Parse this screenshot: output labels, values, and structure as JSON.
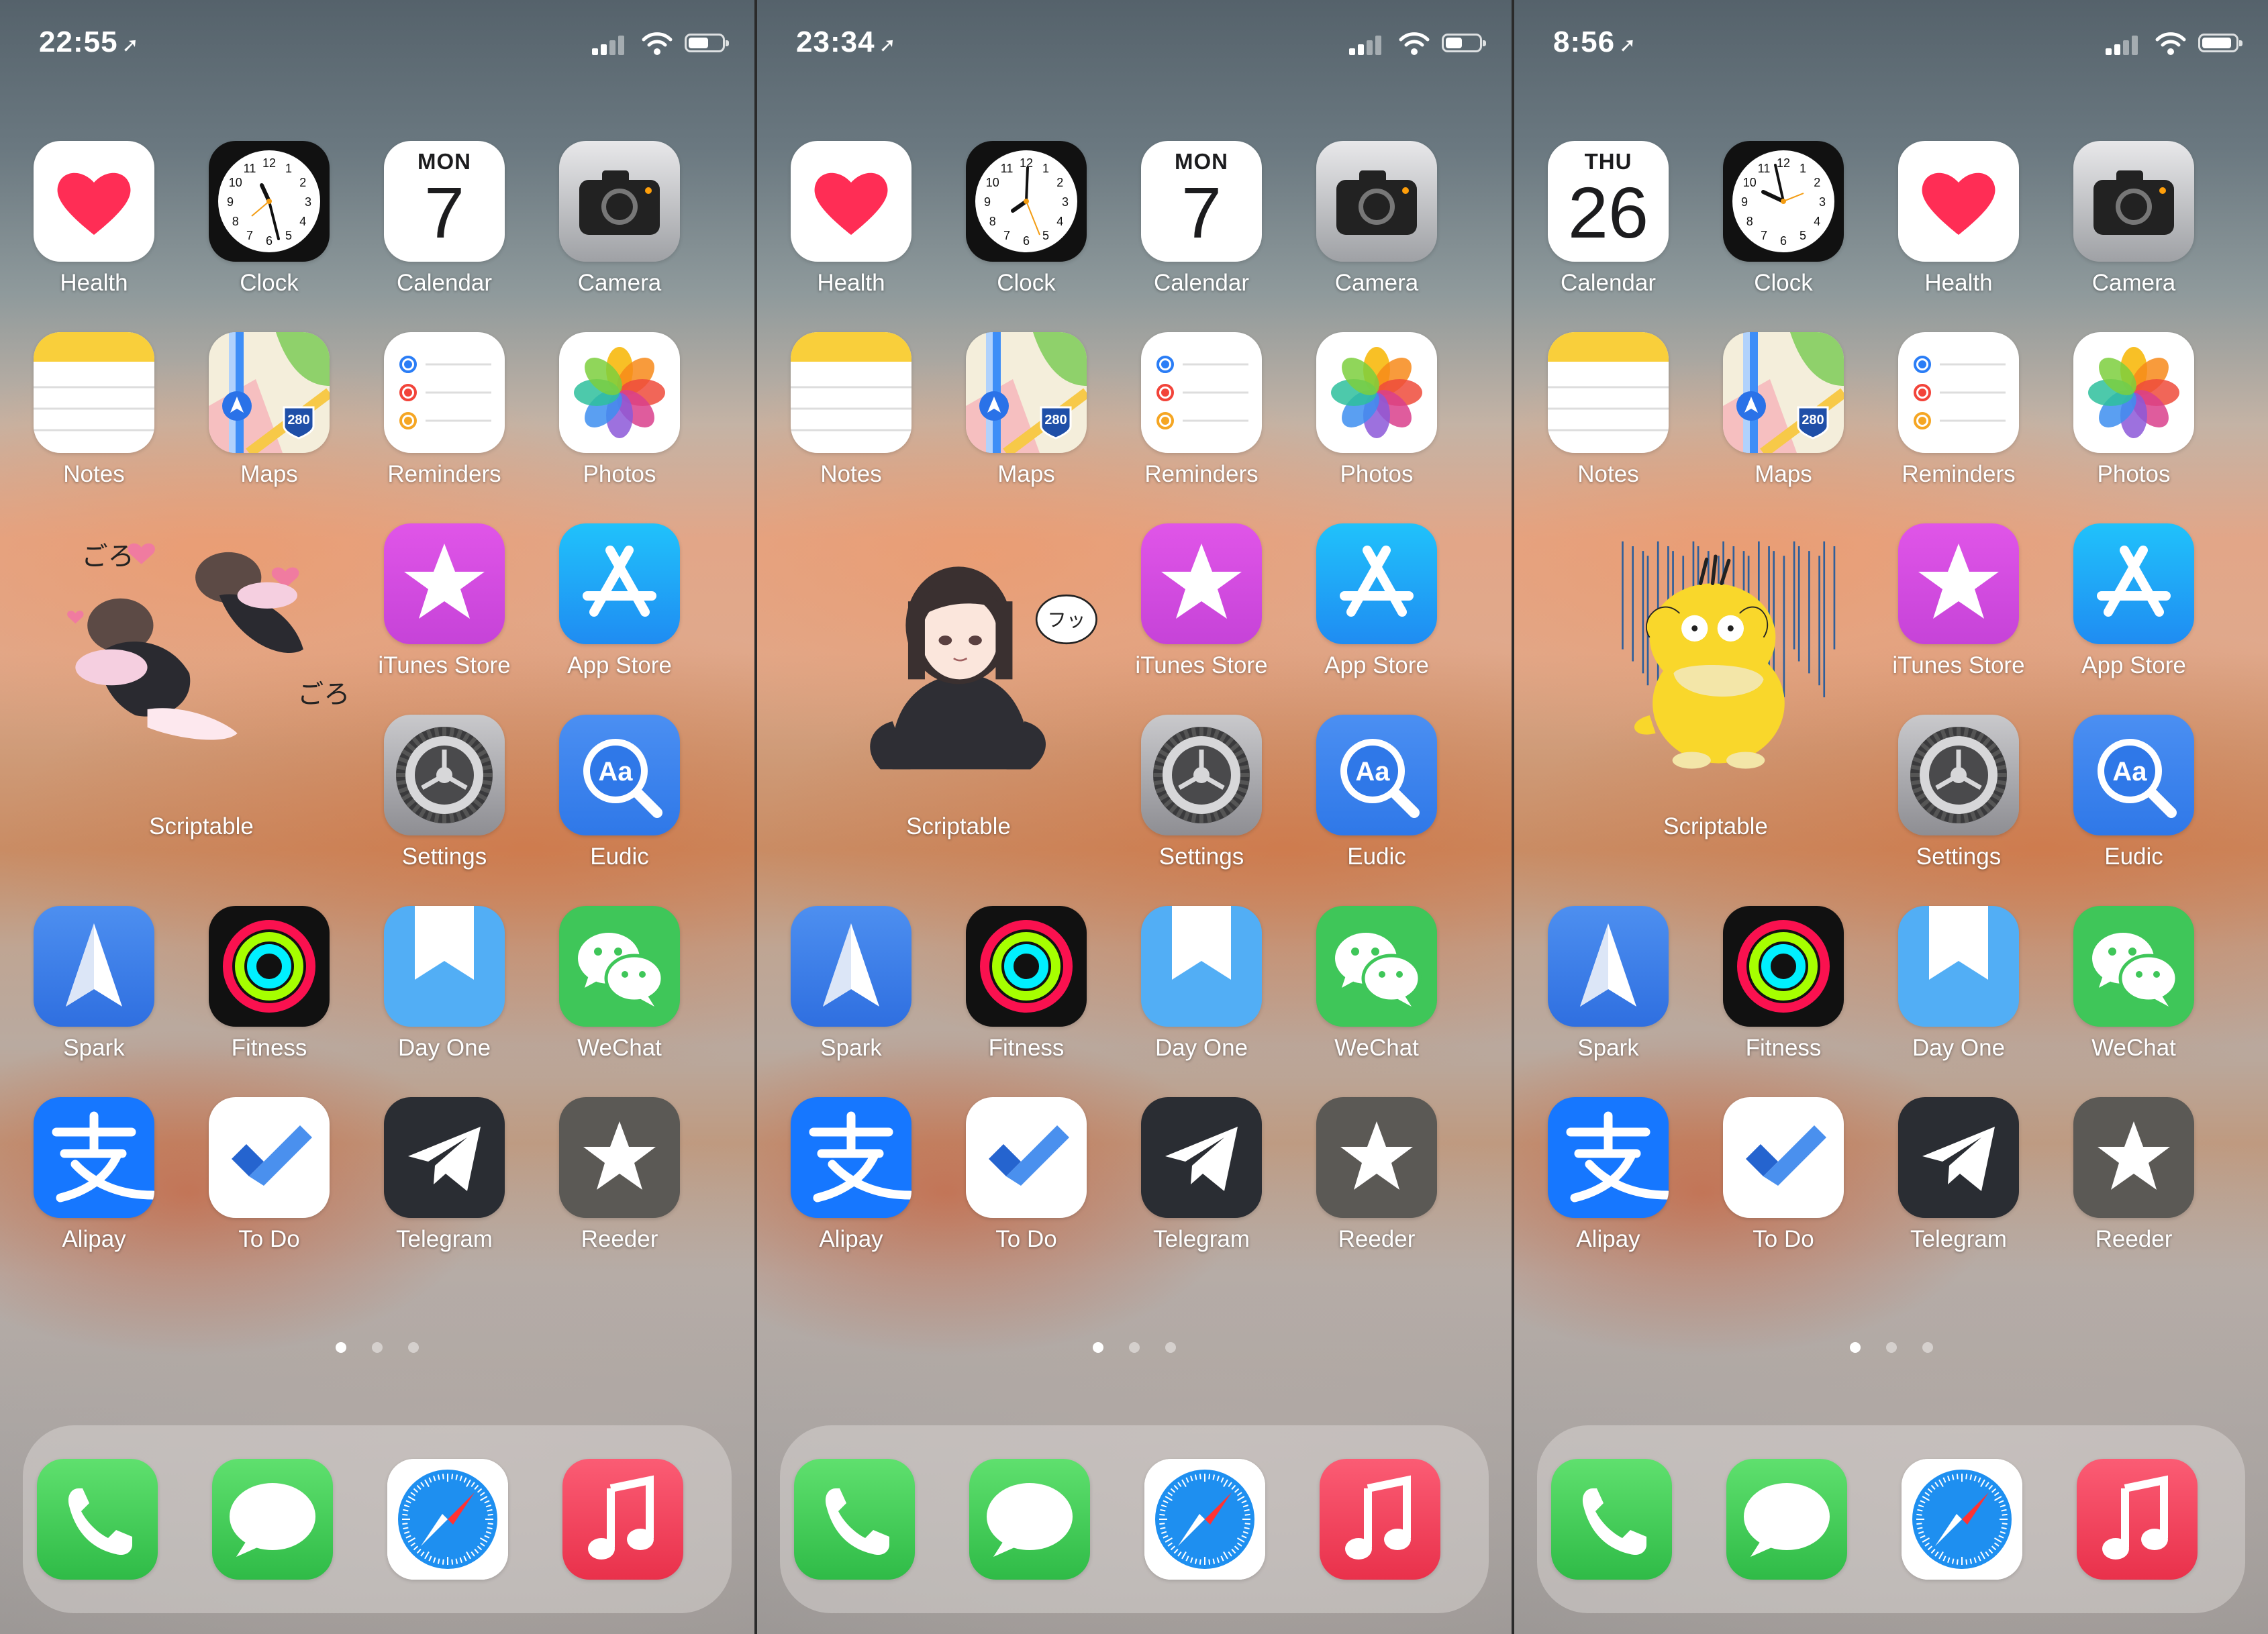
{
  "screens": [
    {
      "time": "22:55",
      "battery_level": 0.6,
      "widget_label": "Scriptable",
      "calendar": {
        "day": "MON",
        "date": "7"
      },
      "row1": [
        "Health",
        "Clock",
        "Calendar",
        "Camera"
      ],
      "row2": [
        "Notes",
        "Maps",
        "Reminders",
        "Photos"
      ],
      "row3": [
        "iTunes Store",
        "App Store"
      ],
      "row4": [
        "Settings",
        "Eudic"
      ],
      "row5": [
        "Spark",
        "Fitness",
        "Day One",
        "WeChat"
      ],
      "row6": [
        "Alipay",
        "To Do",
        "Telegram",
        "Reeder"
      ],
      "active_page": 0
    },
    {
      "time": "23:34",
      "battery_level": 0.5,
      "widget_label": "Scriptable",
      "calendar": {
        "day": "MON",
        "date": "7"
      },
      "row1": [
        "Health",
        "Clock",
        "Calendar",
        "Camera"
      ],
      "row2": [
        "Notes",
        "Maps",
        "Reminders",
        "Photos"
      ],
      "row3": [
        "iTunes Store",
        "App Store"
      ],
      "row4": [
        "Settings",
        "Eudic"
      ],
      "row5": [
        "Spark",
        "Fitness",
        "Day One",
        "WeChat"
      ],
      "row6": [
        "Alipay",
        "To Do",
        "Telegram",
        "Reeder"
      ],
      "active_page": 0
    },
    {
      "time": "8:56",
      "battery_level": 0.9,
      "widget_label": "Scriptable",
      "calendar": {
        "day": "THU",
        "date": "26"
      },
      "row1": [
        "Calendar",
        "Clock",
        "Health",
        "Camera"
      ],
      "row2": [
        "Notes",
        "Maps",
        "Reminders",
        "Photos"
      ],
      "row3": [
        "iTunes Store",
        "App Store"
      ],
      "row4": [
        "Settings",
        "Eudic"
      ],
      "row5": [
        "Spark",
        "Fitness",
        "Day One",
        "WeChat"
      ],
      "row6": [
        "Alipay",
        "To Do",
        "Telegram",
        "Reeder"
      ],
      "active_page": 0
    }
  ],
  "page_count": 3,
  "dock": [
    "phone-icon",
    "messages-icon",
    "safari-icon",
    "music-icon"
  ],
  "maps_shield": "280",
  "widget_text": {
    "p1_top": "ごろ",
    "p1_bottom": "ごろ",
    "p2_bubble": "フッ"
  },
  "colors": {
    "health_heart": "#ff2d55",
    "itunes": "#c643d8",
    "appstore": "#1f8cf2",
    "eudic": "#2f78e8",
    "spark": "#2f6fe0",
    "dayone": "#52aef5",
    "wechat": "#3fc659",
    "alipay": "#1677ff",
    "telegram": "#2a2d33",
    "reeder": "#5b5955",
    "phone": "#3fcb56",
    "music": "#f04256"
  }
}
